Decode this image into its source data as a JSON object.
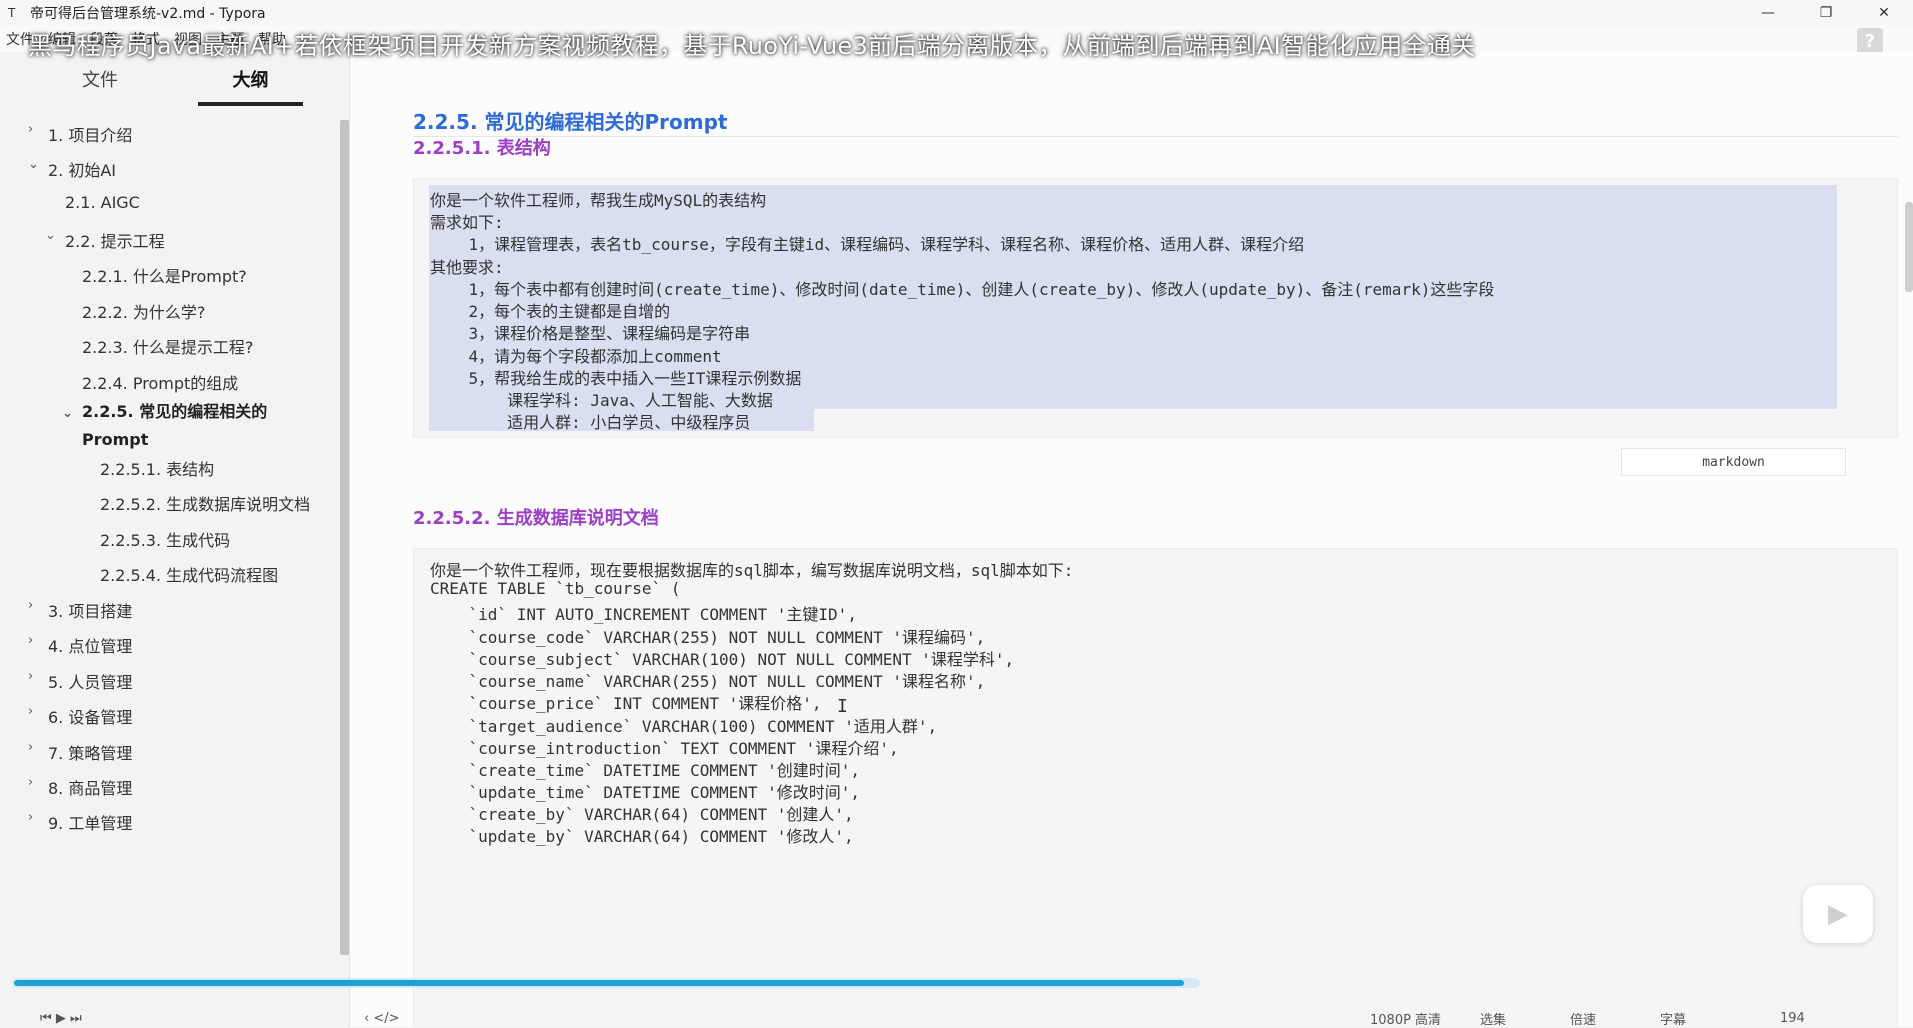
{
  "window": {
    "title": "帝可得后台管理系统-v2.md - Typora",
    "app_icon": "T",
    "minimize": "—",
    "maximize": "❐",
    "close": "✕"
  },
  "menubar": {
    "items": [
      "文件",
      "编辑",
      "段落",
      "格式",
      "视图",
      "主题",
      "帮助"
    ]
  },
  "overlay_title": "黑马程序员Java最新AI+若依框架项目开发新方案视频教程，基于RuoYi-Vue3前后端分离版本，从前端到后端再到AI智能化应用全通关",
  "help_icon": "?",
  "sidebar": {
    "tabs": {
      "files": "文件",
      "outline": "大纲"
    },
    "outline": [
      {
        "label": "1. 项目介绍",
        "chev": "›"
      },
      {
        "label": "2. 初始AI",
        "chev": "⌄"
      },
      {
        "label": "2.1. AIGC",
        "chev": ""
      },
      {
        "label": "2.2. 提示工程",
        "chev": "⌄"
      },
      {
        "label": "2.2.1. 什么是Prompt?",
        "chev": ""
      },
      {
        "label": "2.2.2. 为什么学?",
        "chev": ""
      },
      {
        "label": "2.2.3. 什么是提示工程?",
        "chev": ""
      },
      {
        "label": "2.2.4. Prompt的组成",
        "chev": ""
      },
      {
        "label": "2.2.5. 常见的编程相关的 Prompt",
        "chev": "⌄"
      },
      {
        "label": "2.2.5.1. 表结构",
        "chev": ""
      },
      {
        "label": "2.2.5.2. 生成数据库说明文档",
        "chev": ""
      },
      {
        "label": "2.2.5.3. 生成代码",
        "chev": ""
      },
      {
        "label": "2.2.5.4. 生成代码流程图",
        "chev": ""
      },
      {
        "label": "3. 项目搭建",
        "chev": "›"
      },
      {
        "label": "4. 点位管理",
        "chev": "›"
      },
      {
        "label": "5. 人员管理",
        "chev": "›"
      },
      {
        "label": "6. 设备管理",
        "chev": "›"
      },
      {
        "label": "7. 策略管理",
        "chev": "›"
      },
      {
        "label": "8. 商品管理",
        "chev": "›"
      },
      {
        "label": "9. 工单管理",
        "chev": "›"
      }
    ]
  },
  "content": {
    "h3": "2.2.5.  常见的编程相关的Prompt",
    "h4_1": "2.2.5.1.  表结构",
    "code1": [
      "你是一个软件工程师，帮我生成MySQL的表结构",
      "需求如下:",
      "    1，课程管理表，表名tb_course，字段有主键id、课程编码、课程学科、课程名称、课程价格、适用人群、课程介绍",
      "其他要求:",
      "    1，每个表中都有创建时间(create_time)、修改时间(date_time)、创建人(create_by)、修改人(update_by)、备注(remark)这些字段",
      "    2，每个表的主键都是自增的",
      "    3，课程价格是整型、课程编码是字符串",
      "    4，请为每个字段都添加上comment",
      "    5，帮我给生成的表中插入一些IT课程示例数据",
      "        课程学科: Java、人工智能、大数据",
      "        适用人群: 小白学员、中级程序员"
    ],
    "lang_tag": "markdown",
    "h4_2": "2.2.5.2.  生成数据库说明文档",
    "code2": [
      "你是一个软件工程师，现在要根据数据库的sql脚本，编写数据库说明文档，sql脚本如下:",
      "CREATE TABLE `tb_course` (",
      "    `id` INT AUTO_INCREMENT COMMENT '主键ID',",
      "    `course_code` VARCHAR(255) NOT NULL COMMENT '课程编码',",
      "    `course_subject` VARCHAR(100) NOT NULL COMMENT '课程学科',",
      "    `course_name` VARCHAR(255) NOT NULL COMMENT '课程名称',",
      "    `course_price` INT COMMENT '课程价格',",
      "    `target_audience` VARCHAR(100) COMMENT '适用人群',",
      "    `course_introduction` TEXT COMMENT '课程介绍',",
      "    `create_time` DATETIME COMMENT '创建时间',",
      "    `update_time` DATETIME COMMENT '修改时间',",
      "    `create_by` VARCHAR(64) COMMENT '创建人',",
      "    `update_by` VARCHAR(64) COMMENT '修改人',"
    ]
  },
  "player": {
    "progress": 0.985,
    "play_icon": "▶",
    "left_text": "⏮ ▶ ⏭",
    "toc_icon": "‹  </>",
    "right_items": [
      "1080P 高清",
      "选集",
      "倍速",
      "字幕",
      "194"
    ]
  },
  "colors": {
    "heading": "#2f6bd6",
    "subheading": "#9b3fc6",
    "selection": "#d9dff0",
    "progress": "#1aa3d8"
  }
}
